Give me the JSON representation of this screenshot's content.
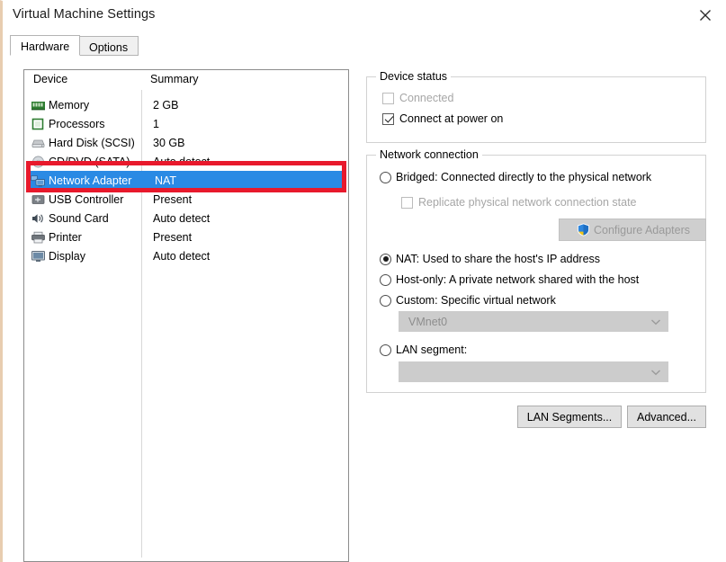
{
  "window": {
    "title": "Virtual Machine Settings",
    "close_icon": "close-icon"
  },
  "tabs": [
    {
      "label": "Hardware",
      "active": true
    },
    {
      "label": "Options",
      "active": false
    }
  ],
  "device_list": {
    "columns": {
      "device": "Device",
      "summary": "Summary"
    },
    "rows": [
      {
        "icon": "memory-icon",
        "device": "Memory",
        "summary": "2 GB",
        "selected": false
      },
      {
        "icon": "processor-icon",
        "device": "Processors",
        "summary": "1",
        "selected": false
      },
      {
        "icon": "hard-disk-icon",
        "device": "Hard Disk (SCSI)",
        "summary": "30 GB",
        "selected": false
      },
      {
        "icon": "cd-dvd-icon",
        "device": "CD/DVD (SATA)",
        "summary": "Auto detect",
        "selected": false
      },
      {
        "icon": "network-adapter-icon",
        "device": "Network Adapter",
        "summary": "NAT",
        "selected": true
      },
      {
        "icon": "usb-controller-icon",
        "device": "USB Controller",
        "summary": "Present",
        "selected": false
      },
      {
        "icon": "sound-card-icon",
        "device": "Sound Card",
        "summary": "Auto detect",
        "selected": false
      },
      {
        "icon": "printer-icon",
        "device": "Printer",
        "summary": "Present",
        "selected": false
      },
      {
        "icon": "display-icon",
        "device": "Display",
        "summary": "Auto detect",
        "selected": false
      }
    ]
  },
  "annotation": {
    "highlight_color": "#e8192c",
    "target_row": "Network Adapter"
  },
  "device_status": {
    "legend": "Device status",
    "connected": {
      "label": "Connected",
      "checked": false,
      "disabled": true
    },
    "connect_at_power_on": {
      "label": "Connect at power on",
      "checked": true,
      "disabled": false
    }
  },
  "network_connection": {
    "legend": "Network connection",
    "bridged": {
      "label": "Bridged: Connected directly to the physical network",
      "selected": false
    },
    "replicate": {
      "label": "Replicate physical network connection state",
      "checked": false,
      "disabled": true
    },
    "configure_adapters": {
      "label": "Configure Adapters",
      "icon": "uac-shield-icon",
      "disabled": true
    },
    "nat": {
      "label": "NAT: Used to share the host's IP address",
      "selected": true
    },
    "host_only": {
      "label": "Host-only: A private network shared with the host",
      "selected": false
    },
    "custom": {
      "label": "Custom: Specific virtual network",
      "selected": false
    },
    "custom_combo": {
      "value": "VMnet0",
      "disabled": true,
      "icon": "chevron-down-icon"
    },
    "lan_segment": {
      "label": "LAN segment:",
      "selected": false
    },
    "lan_segment_combo": {
      "value": "",
      "disabled": true,
      "icon": "chevron-down-icon"
    }
  },
  "footer_buttons": {
    "lan_segments": "LAN Segments...",
    "advanced": "Advanced..."
  },
  "colors": {
    "selection_blue": "#2a8ae4",
    "annotation_red": "#e8192c",
    "disabled_gray": "#a6a6a6"
  }
}
